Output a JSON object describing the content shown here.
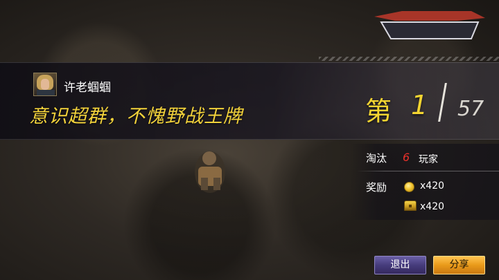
{
  "game": {
    "logo_text": " "
  },
  "player": {
    "name": "许老蝈蝈",
    "avatar": "female-soldier-avatar"
  },
  "result": {
    "title": "意识超群，不愧野战王牌",
    "rank_prefix": "第",
    "rank": "1",
    "total": "57"
  },
  "stats": {
    "kills_label": "淘汰",
    "kills_value": "6",
    "kills_unit": "玩家",
    "reward_label": "奖励",
    "reward_coins": "x420",
    "reward_chest": "x420"
  },
  "buttons": {
    "exit": "退出",
    "share": "分享"
  },
  "colors": {
    "gold": "#f4d531",
    "kill_red": "#e8302a",
    "exit_purple": "#463c7c",
    "share_orange": "#e99a1a"
  }
}
